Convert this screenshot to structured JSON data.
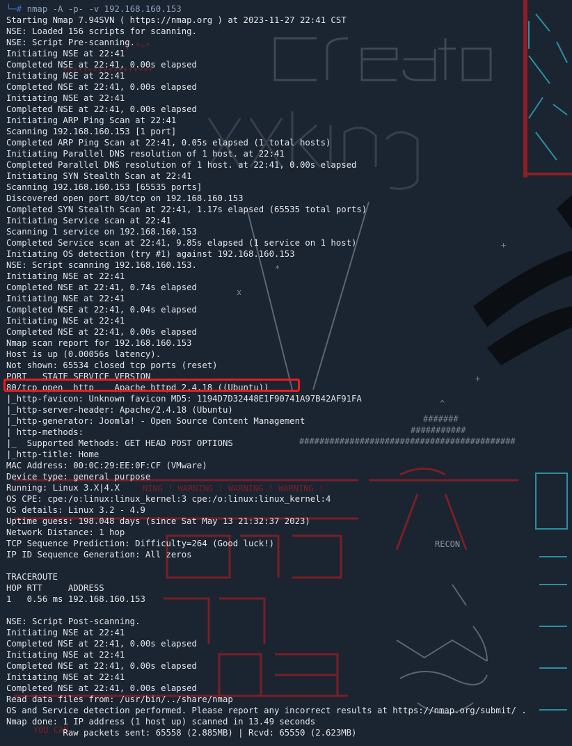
{
  "prompt": {
    "symbol": "└─#",
    "command": " nmap -A -p- -v 192.168.160.153"
  },
  "lines": [
    "Starting Nmap 7.94SVN ( https://nmap.org ) at 2023-11-27 22:41 CST",
    "NSE: Loaded 156 scripts for scanning.",
    "NSE: Script Pre-scanning.",
    "Initiating NSE at 22:41",
    "Completed NSE at 22:41, 0.00s elapsed",
    "Initiating NSE at 22:41",
    "Completed NSE at 22:41, 0.00s elapsed",
    "Initiating NSE at 22:41",
    "Completed NSE at 22:41, 0.00s elapsed",
    "Initiating ARP Ping Scan at 22:41",
    "Scanning 192.168.160.153 [1 port]",
    "Completed ARP Ping Scan at 22:41, 0.05s elapsed (1 total hosts)",
    "Initiating Parallel DNS resolution of 1 host. at 22:41",
    "Completed Parallel DNS resolution of 1 host. at 22:41, 0.00s elapsed",
    "Initiating SYN Stealth Scan at 22:41",
    "Scanning 192.168.160.153 [65535 ports]",
    "Discovered open port 80/tcp on 192.168.160.153",
    "Completed SYN Stealth Scan at 22:41, 1.17s elapsed (65535 total ports)",
    "Initiating Service scan at 22:41",
    "Scanning 1 service on 192.168.160.153",
    "Completed Service scan at 22:41, 9.85s elapsed (1 service on 1 host)",
    "Initiating OS detection (try #1) against 192.168.160.153",
    "NSE: Script scanning 192.168.160.153.",
    "Initiating NSE at 22:41",
    "Completed NSE at 22:41, 0.74s elapsed",
    "Initiating NSE at 22:41",
    "Completed NSE at 22:41, 0.04s elapsed",
    "Initiating NSE at 22:41",
    "Completed NSE at 22:41, 0.00s elapsed",
    "Nmap scan report for 192.168.160.153",
    "Host is up (0.00056s latency).",
    "Not shown: 65534 closed tcp ports (reset)",
    "PORT   STATE SERVICE VERSION",
    "80/tcp open  http    Apache httpd 2.4.18 ((Ubuntu))",
    "|_http-favicon: Unknown favicon MD5: 1194D7D32448E1F90741A97B42AF91FA",
    "|_http-server-header: Apache/2.4.18 (Ubuntu)",
    "|_http-generator: Joomla! - Open Source Content Management",
    "| http-methods:",
    "|_  Supported Methods: GET HEAD POST OPTIONS",
    "|_http-title: Home",
    "MAC Address: 00:0C:29:EE:0F:CF (VMware)",
    "Device type: general purpose",
    "Running: Linux 3.X|4.X",
    "OS CPE: cpe:/o:linux:linux_kernel:3 cpe:/o:linux:linux_kernel:4",
    "OS details: Linux 3.2 - 4.9",
    "Uptime guess: 198.048 days (since Sat May 13 21:32:37 2023)",
    "Network Distance: 1 hop",
    "TCP Sequence Prediction: Difficulty=264 (Good luck!)",
    "IP ID Sequence Generation: All zeros",
    "",
    "TRACEROUTE",
    "HOP RTT     ADDRESS",
    "1   0.56 ms 192.168.160.153",
    "",
    "NSE: Script Post-scanning.",
    "Initiating NSE at 22:41",
    "Completed NSE at 22:41, 0.00s elapsed",
    "Initiating NSE at 22:41",
    "Completed NSE at 22:41, 0.00s elapsed",
    "Initiating NSE at 22:41",
    "Completed NSE at 22:41, 0.00s elapsed",
    "Read data files from: /usr/bin/../share/nmap",
    "OS and Service detection performed. Please report any incorrect results at https://nmap.org/submit/ .",
    "Nmap done: 1 IP address (1 host up) scanned in 13.49 seconds",
    "           Raw packets sent: 65558 (2.885MB) | Rcvd: 65550 (2.623MB)"
  ],
  "highlight": {
    "line_index": 33,
    "color": "#ee1b1b"
  },
  "colors": {
    "background": "#1b2431",
    "text": "#e3e6ea",
    "prompt": "#3c78c8",
    "wallpaper_red": "#8a1f24",
    "wallpaper_gray": "#7b8594",
    "wallpaper_cyan": "#2fb4c4"
  }
}
